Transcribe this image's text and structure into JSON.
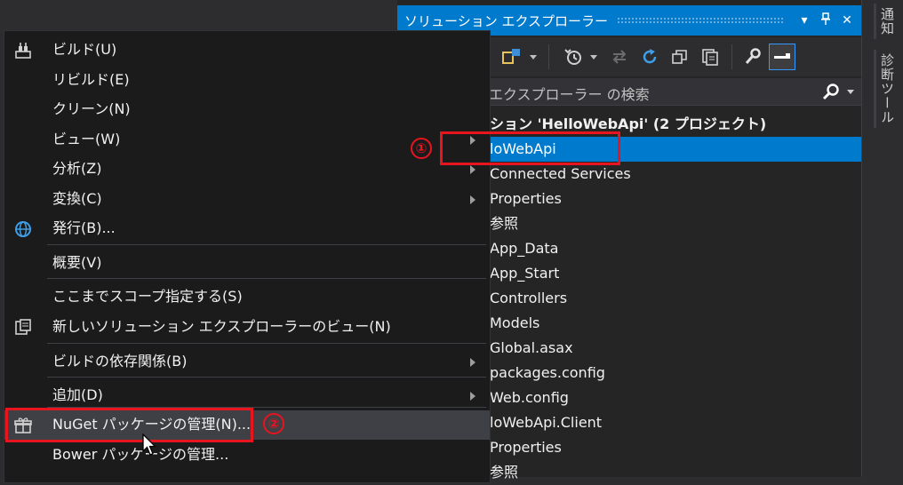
{
  "solution_explorer": {
    "title": "ソリューション エクスプローラー",
    "title_buttons": [
      "▾",
      "⊥",
      "✕"
    ],
    "search_placeholder": "エクスプローラー の検索",
    "tree": [
      {
        "label": "ション 'HelloWebApi' (2 プロジェクト)",
        "bold": true,
        "selected": false
      },
      {
        "label": "loWebApi",
        "bold": false,
        "selected": true
      },
      {
        "label": "Connected Services"
      },
      {
        "label": "Properties"
      },
      {
        "label": "参照"
      },
      {
        "label": "App_Data"
      },
      {
        "label": "App_Start"
      },
      {
        "label": "Controllers"
      },
      {
        "label": "Models"
      },
      {
        "label": "Global.asax"
      },
      {
        "label": "packages.config"
      },
      {
        "label": "Web.config"
      },
      {
        "label": "loWebApi.Client"
      },
      {
        "label": "Properties"
      },
      {
        "label": "参照"
      }
    ]
  },
  "side_tabs": [
    "通知",
    "診断ツール"
  ],
  "context_menu": {
    "items": [
      {
        "label": "ビルド(U)",
        "icon": "build-icon"
      },
      {
        "label": "リビルド(E)"
      },
      {
        "label": "クリーン(N)"
      },
      {
        "label": "ビュー(W)",
        "submenu": true
      },
      {
        "label": "分析(Z)",
        "submenu": true
      },
      {
        "label": "変換(C)",
        "submenu": true
      },
      {
        "label": "発行(B)...",
        "icon": "globe-icon"
      },
      {
        "label": "概要(V)"
      },
      {
        "label": "ここまでスコープ指定する(S)"
      },
      {
        "label": "新しいソリューション エクスプローラーのビュー(N)",
        "icon": "new-view-icon"
      },
      {
        "label": "ビルドの依存関係(B)",
        "submenu": true
      },
      {
        "label": "追加(D)",
        "submenu": true
      },
      {
        "label": "NuGet パッケージの管理(N)...",
        "icon": "gift-icon",
        "hover": true
      },
      {
        "label": "Bower パッケージの管理..."
      }
    ]
  },
  "annotations": {
    "badge1": "①",
    "badge2": "②"
  },
  "colors": {
    "accent": "#007acc",
    "annotation": "#e8141e",
    "menu_bg": "#1b1b1c"
  }
}
